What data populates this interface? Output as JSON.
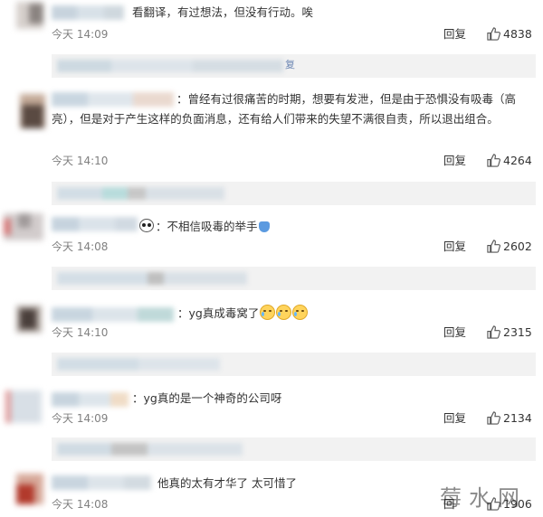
{
  "colors": {
    "background": "#ffffff",
    "text": "#333333",
    "muted": "#808080",
    "sub_reply_bg": "#f2f2f2"
  },
  "icons": {
    "like": "thumbs-up-icon",
    "emoji": "crying-face-emoji"
  },
  "comments": [
    {
      "text": "看翻译，有过想法，但没有行动。唉",
      "time": "今天 14:09",
      "reply_label": "回复",
      "likes": "4838",
      "sub_reply_tail": "复"
    },
    {
      "text": "：曾经有过很痛苦的时期，想要有发泄，但是由于恐惧没有吸毒（高亮），但是对于产生这样的负面消息，还有给人们带来的失望不满很自责，所以退出组合。",
      "time": "今天 14:10",
      "reply_label": "回复",
      "likes": "4264"
    },
    {
      "text": "：不相信吸毒的举手",
      "time": "今天 14:08",
      "reply_label": "回复",
      "likes": "2602"
    },
    {
      "text": "：yg真成毒窝了",
      "time": "今天 14:10",
      "reply_label": "回复",
      "likes": "2315"
    },
    {
      "text": "：yg真的是一个神奇的公司呀",
      "time": "今天 14:09",
      "reply_label": "回复",
      "likes": "2134"
    },
    {
      "text": "他真的太有才华了 太可惜了",
      "time": "今天 14:08",
      "reply_label": "回",
      "likes": "1906"
    }
  ],
  "watermark": "莓水网"
}
